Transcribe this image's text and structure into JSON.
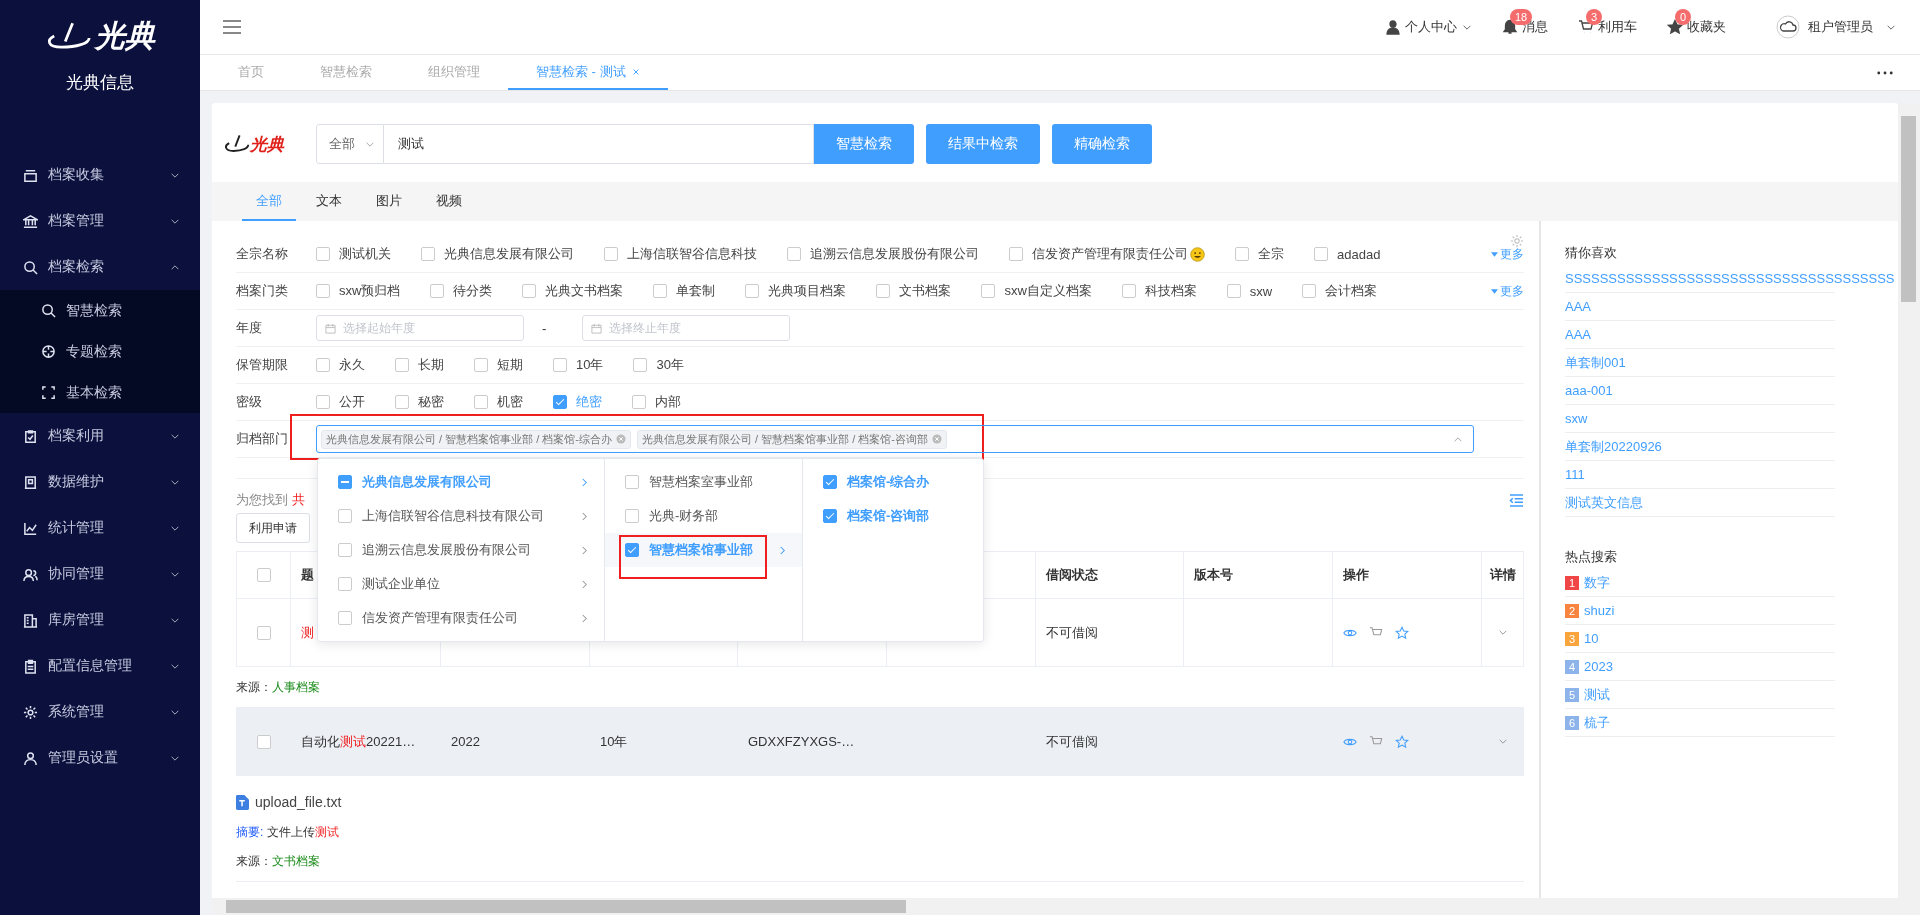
{
  "sidebar": {
    "logo_text": "光典",
    "title": "光典信息",
    "items": [
      {
        "label": "档案收集",
        "expanded": false
      },
      {
        "label": "档案管理",
        "expanded": false
      },
      {
        "label": "档案检索",
        "expanded": true,
        "children": [
          {
            "label": "智慧检索"
          },
          {
            "label": "专题检索"
          },
          {
            "label": "基本检索"
          }
        ]
      },
      {
        "label": "档案利用",
        "expanded": false
      },
      {
        "label": "数据维护",
        "expanded": false
      },
      {
        "label": "统计管理",
        "expanded": false
      },
      {
        "label": "协同管理",
        "expanded": false
      },
      {
        "label": "库房管理",
        "expanded": false
      },
      {
        "label": "配置信息管理",
        "expanded": false
      },
      {
        "label": "系统管理",
        "expanded": false
      },
      {
        "label": "管理员设置",
        "expanded": false
      }
    ]
  },
  "header": {
    "links": [
      {
        "label": "个人中心",
        "dropdown": true
      },
      {
        "label": "消息",
        "badge": "18"
      },
      {
        "label": "利用车",
        "badge": "3"
      },
      {
        "label": "收藏夹",
        "badge": "0"
      }
    ],
    "user": "租户管理员"
  },
  "tabs": [
    {
      "label": "首页",
      "selected": false,
      "closable": false
    },
    {
      "label": "智慧检索",
      "selected": false,
      "closable": false
    },
    {
      "label": "组织管理",
      "selected": false,
      "closable": false
    },
    {
      "label": "智慧检索 - 测试",
      "selected": true,
      "closable": true
    }
  ],
  "search": {
    "logo_text": "光典",
    "scope": "全部",
    "query": "测试",
    "buttons": [
      "智慧检索",
      "结果中检索",
      "精确检索"
    ]
  },
  "content_tabs": [
    {
      "label": "全部",
      "selected": true
    },
    {
      "label": "文本",
      "selected": false
    },
    {
      "label": "图片",
      "selected": false
    },
    {
      "label": "视频",
      "selected": false
    }
  ],
  "filters": [
    {
      "kind": "checkboxes",
      "label": "全宗名称",
      "more": "更多",
      "options": [
        {
          "label": "测试机关",
          "checked": false
        },
        {
          "label": "光典信息发展有限公司",
          "checked": false
        },
        {
          "label": "上海信联智谷信息科技",
          "checked": false
        },
        {
          "label": "追溯云信息发展股份有限公司",
          "checked": false
        },
        {
          "label": "信发资产管理有限责任公司",
          "checked": false,
          "emoji": true
        },
        {
          "label": "全宗",
          "checked": false
        },
        {
          "label": "adadad",
          "checked": false
        }
      ]
    },
    {
      "kind": "checkboxes",
      "label": "档案门类",
      "more": "更多",
      "options": [
        {
          "label": "sxw预归档",
          "checked": false
        },
        {
          "label": "待分类",
          "checked": false
        },
        {
          "label": "光典文书档案",
          "checked": false
        },
        {
          "label": "单套制",
          "checked": false
        },
        {
          "label": "光典项目档案",
          "checked": false
        },
        {
          "label": "文书档案",
          "checked": false
        },
        {
          "label": "sxw自定义档案",
          "checked": false
        },
        {
          "label": "科技档案",
          "checked": false
        },
        {
          "label": "sxw",
          "checked": false
        },
        {
          "label": "会计档案",
          "checked": false
        }
      ]
    },
    {
      "kind": "date_range",
      "label": "年度",
      "start_placeholder": "选择起始年度",
      "separator": "-",
      "end_placeholder": "选择终止年度"
    },
    {
      "kind": "checkboxes",
      "label": "保管期限",
      "options": [
        {
          "label": "永久",
          "checked": false
        },
        {
          "label": "长期",
          "checked": false
        },
        {
          "label": "短期",
          "checked": false
        },
        {
          "label": "10年",
          "checked": false
        },
        {
          "label": "30年",
          "checked": false
        }
      ]
    },
    {
      "kind": "checkboxes",
      "label": "密级",
      "options": [
        {
          "label": "公开",
          "checked": false
        },
        {
          "label": "秘密",
          "checked": false
        },
        {
          "label": "机密",
          "checked": false
        },
        {
          "label": "绝密",
          "checked": true
        },
        {
          "label": "内部",
          "checked": false
        }
      ]
    },
    {
      "kind": "cascader",
      "label": "归档部门",
      "annotated": true,
      "open": true,
      "tags": [
        "光典信息发展有限公司 / 智慧档案馆事业部 / 档案馆-综合办",
        "光典信息发展有限公司 / 智慧档案馆事业部 / 档案馆-咨询部"
      ],
      "dropdown": [
        [
          {
            "label": "光典信息发展有限公司",
            "indeterminate": true,
            "selected": true,
            "expandable": true,
            "annotated": false
          },
          {
            "label": "上海信联智谷信息科技有限公司",
            "checked": false,
            "selected": false,
            "expandable": true,
            "annotated": false
          },
          {
            "label": "追溯云信息发展股份有限公司",
            "checked": false,
            "selected": false,
            "expandable": true,
            "annotated": false
          },
          {
            "label": "测试企业单位",
            "checked": false,
            "selected": false,
            "expandable": true,
            "annotated": false
          },
          {
            "label": "信发资产管理有限责任公司",
            "checked": false,
            "selected": false,
            "expandable": true,
            "annotated": false
          }
        ],
        [
          {
            "label": "智慧档案室事业部",
            "checked": false,
            "selected": false,
            "expandable": false,
            "annotated": false
          },
          {
            "label": "光典-财务部",
            "checked": false,
            "selected": false,
            "expandable": false,
            "annotated": false
          },
          {
            "label": "智慧档案馆事业部",
            "checked": true,
            "selected": true,
            "expandable": true,
            "annotated": true
          }
        ],
        [
          {
            "label": "档案馆-综合办",
            "checked": true,
            "selected": true,
            "expandable": false,
            "annotated": false
          },
          {
            "label": "档案馆-咨询部",
            "checked": true,
            "selected": true,
            "expandable": false,
            "annotated": false
          }
        ]
      ]
    }
  ],
  "results": {
    "prefix": "为您找到",
    "count": "共",
    "buttons": [
      "利用申请"
    ]
  },
  "table": {
    "select_all": false,
    "columns": [
      null,
      "题",
      null,
      null,
      null,
      null,
      "借阅状态",
      "版本号",
      "操作",
      "详情"
    ],
    "rows": [
      {
        "checked": false,
        "highlighted": false,
        "title": [
          {
            "text": "测",
            "hit": true
          }
        ],
        "cells": [
          null,
          null,
          null,
          null,
          "不可借阅",
          null
        ],
        "source_label": "来源：",
        "source": "人事档案"
      },
      {
        "checked": false,
        "highlighted": true,
        "title": [
          {
            "text": "自动化",
            "hit": false
          },
          {
            "text": "测试",
            "hit": true
          },
          {
            "text": "20221…",
            "hit": false
          }
        ],
        "cells": [
          "2022",
          "10年",
          "GDXXFZYXGS-…",
          null,
          "不可借阅",
          null
        ],
        "file": "upload_file.txt",
        "summary_label": "摘要:",
        "summary": [
          {
            "text": " 文件上传",
            "hit": false
          },
          {
            "text": "测试",
            "hit": true
          }
        ],
        "source_label": "来源：",
        "source": "文书档案"
      }
    ]
  },
  "recommend": {
    "title": "猜你喜欢",
    "items": [
      "SSSSSSSSSSSSSSSSSSSSSSSSSSSSSSSSSSSSSS",
      "AAA",
      "AAA",
      "单套制001",
      "aaa-001",
      "sxw",
      "单套制20220926",
      "111",
      "测试英文信息"
    ]
  },
  "hot": {
    "title": "热点搜索",
    "items": [
      {
        "rank": "1",
        "text": "数字",
        "color": "#f04645"
      },
      {
        "rank": "2",
        "text": "shuzi",
        "color": "#f7843f"
      },
      {
        "rank": "3",
        "text": "10",
        "color": "#f9a43c"
      },
      {
        "rank": "4",
        "text": "2023",
        "color": "#8db4ea"
      },
      {
        "rank": "5",
        "text": "测试",
        "color": "#8db4ea"
      },
      {
        "rank": "6",
        "text": "梳子",
        "color": "#8db4ea"
      }
    ]
  }
}
